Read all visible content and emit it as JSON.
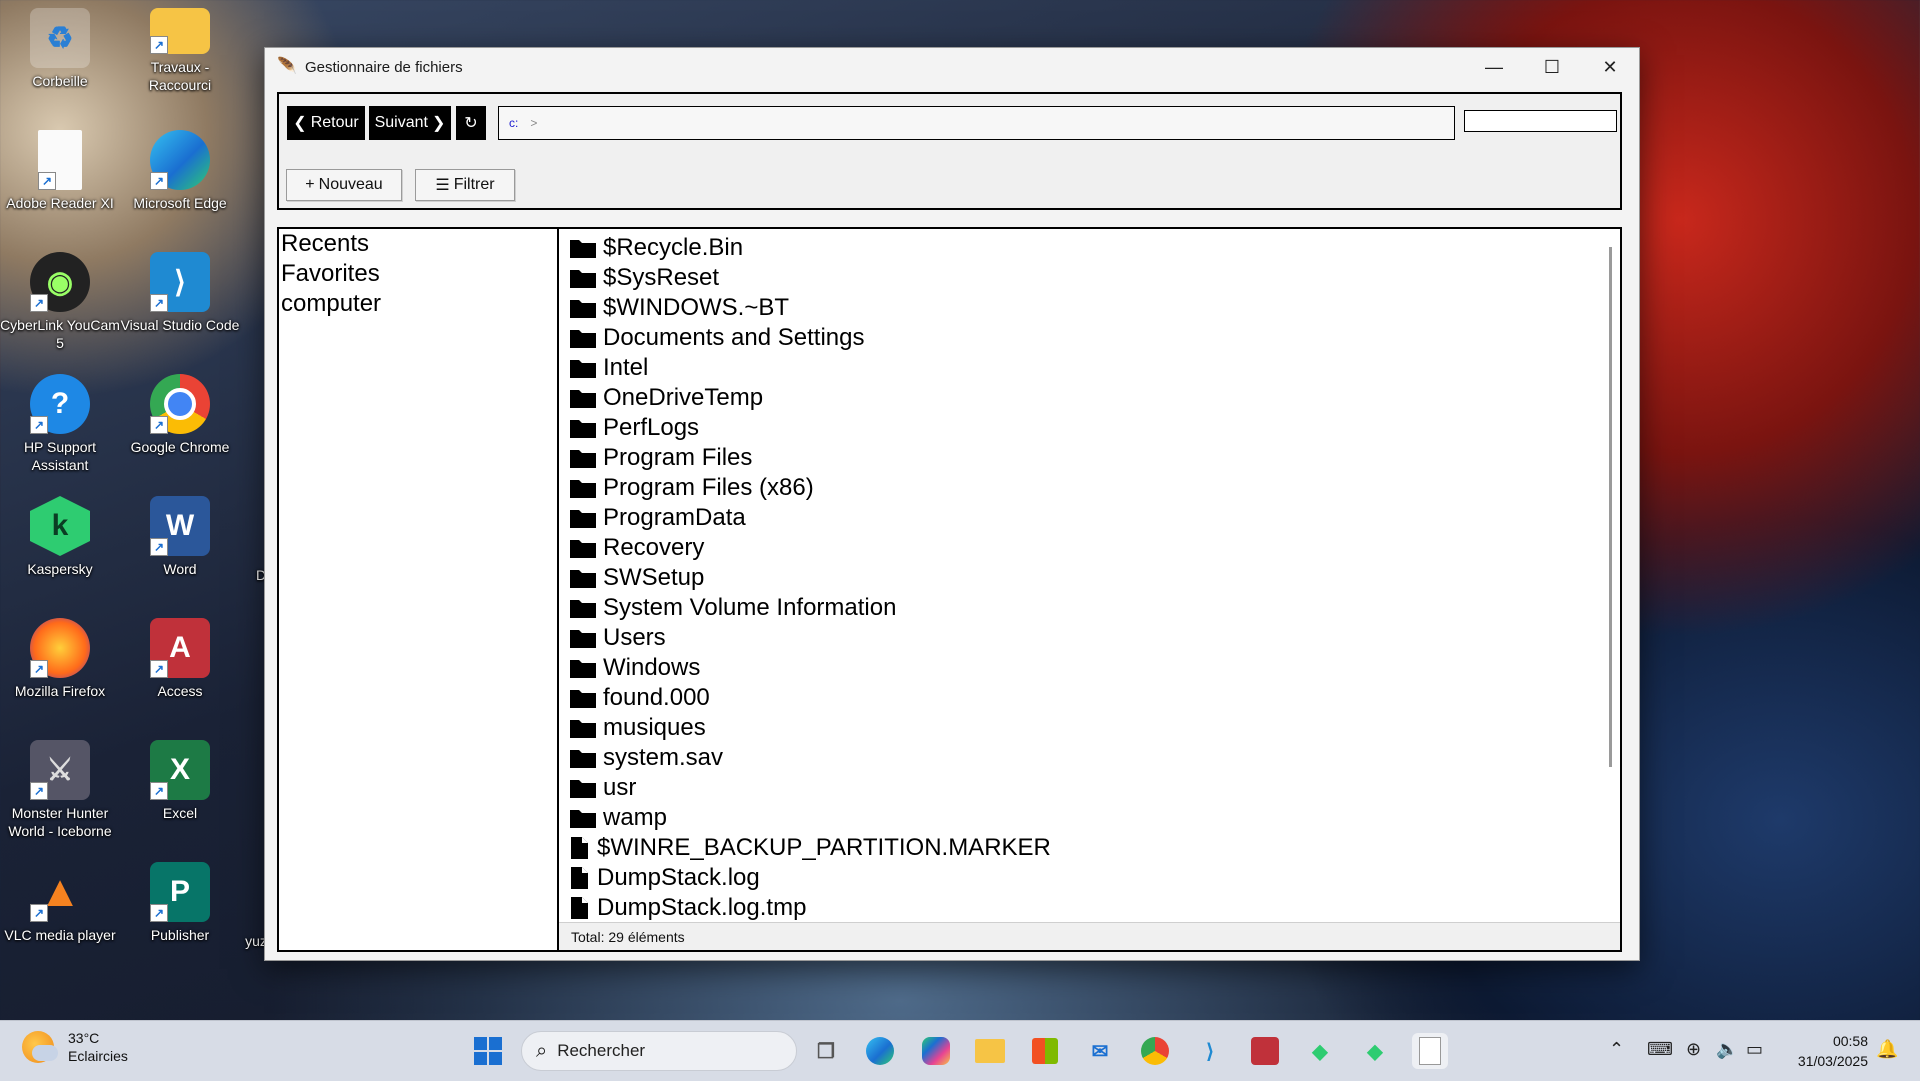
{
  "desktop": {
    "icons": [
      {
        "label": "Corbeille"
      },
      {
        "label": "Travaux - Raccourci"
      },
      {
        "label": "Adobe Reader XI"
      },
      {
        "label": "Microsoft Edge"
      },
      {
        "label": "CyberLink YouCam 5"
      },
      {
        "label": "Visual Studio Code"
      },
      {
        "label": "HP Support Assistant"
      },
      {
        "label": "Google Chrome"
      },
      {
        "label": "Kaspersky"
      },
      {
        "label": "Word"
      },
      {
        "label": "Mozilla Firefox"
      },
      {
        "label": "Access"
      },
      {
        "label": "Monster Hunter World - Iceborne"
      },
      {
        "label": "Excel"
      },
      {
        "label": "VLC media player"
      },
      {
        "label": "Publisher"
      }
    ],
    "partial_labels": [
      "D",
      "yuz"
    ]
  },
  "window": {
    "title": "Gestionnaire de fichiers",
    "controls": {
      "minimize": "—",
      "maximize": "☐",
      "close": "✕"
    }
  },
  "toolbar": {
    "back_label": "Retour",
    "forward_label": "Suivant",
    "refresh_icon": "↻",
    "address": {
      "drive": "c:",
      "separator": ">"
    },
    "search_value": "",
    "new_label": "Nouveau",
    "filter_label": "Filtrer"
  },
  "sidebar": {
    "items": [
      {
        "label": "Recents"
      },
      {
        "label": "Favorites"
      },
      {
        "label": "computer"
      }
    ]
  },
  "files": {
    "items": [
      {
        "name": "$Recycle.Bin",
        "type": "folder"
      },
      {
        "name": "$SysReset",
        "type": "folder"
      },
      {
        "name": "$WINDOWS.~BT",
        "type": "folder"
      },
      {
        "name": "Documents and Settings",
        "type": "folder"
      },
      {
        "name": "Intel",
        "type": "folder"
      },
      {
        "name": "OneDriveTemp",
        "type": "folder"
      },
      {
        "name": "PerfLogs",
        "type": "folder"
      },
      {
        "name": "Program Files",
        "type": "folder"
      },
      {
        "name": "Program Files (x86)",
        "type": "folder"
      },
      {
        "name": "ProgramData",
        "type": "folder"
      },
      {
        "name": "Recovery",
        "type": "folder"
      },
      {
        "name": "SWSetup",
        "type": "folder"
      },
      {
        "name": "System Volume Information",
        "type": "folder"
      },
      {
        "name": "Users",
        "type": "folder"
      },
      {
        "name": "Windows",
        "type": "folder"
      },
      {
        "name": "found.000",
        "type": "folder"
      },
      {
        "name": "musiques",
        "type": "folder"
      },
      {
        "name": "system.sav",
        "type": "folder"
      },
      {
        "name": "usr",
        "type": "folder"
      },
      {
        "name": "wamp",
        "type": "folder"
      },
      {
        "name": "$WINRE_BACKUP_PARTITION.MARKER",
        "type": "file"
      },
      {
        "name": "DumpStack.log",
        "type": "file"
      },
      {
        "name": "DumpStack.log.tmp",
        "type": "file"
      }
    ],
    "status": "Total: 29 éléments"
  },
  "taskbar": {
    "weather_temp": "33°C",
    "weather_desc": "Eclaircies",
    "search_placeholder": "Rechercher",
    "time": "00:58",
    "date": "31/03/2025"
  },
  "colors": {
    "accent": "#1a6fd1",
    "window_bg": "#f3f3f3",
    "taskbar_bg": "#d7dce6"
  }
}
